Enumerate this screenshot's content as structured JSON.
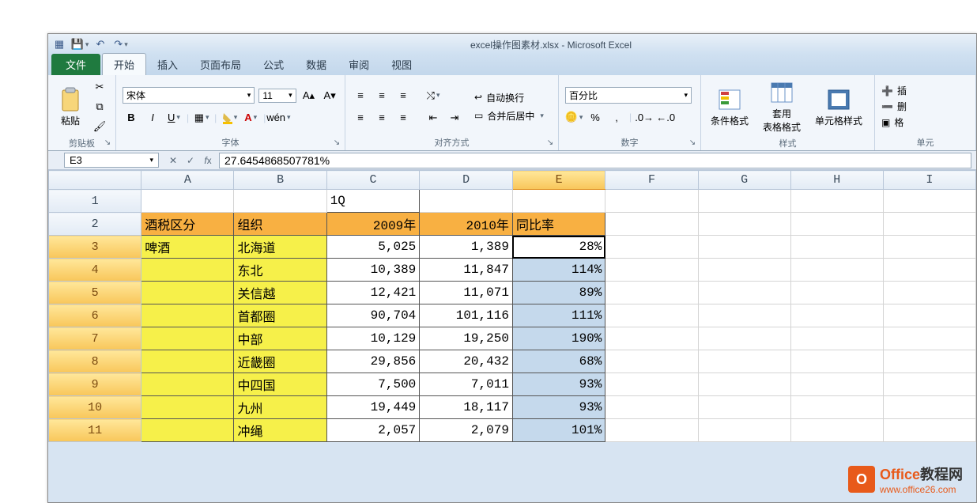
{
  "title": "excel操作图素材.xlsx - Microsoft Excel",
  "tabs": {
    "file": "文件",
    "home": "开始",
    "insert": "插入",
    "layout": "页面布局",
    "formulas": "公式",
    "data": "数据",
    "review": "审阅",
    "view": "视图"
  },
  "ribbon": {
    "clipboard": {
      "label": "剪贴板",
      "paste": "粘贴"
    },
    "font": {
      "label": "字体",
      "name": "宋体",
      "size": "11"
    },
    "alignment": {
      "label": "对齐方式",
      "wrap": "自动换行",
      "merge": "合并后居中"
    },
    "number": {
      "label": "数字",
      "format": "百分比"
    },
    "styles": {
      "label": "样式",
      "conditional": "条件格式",
      "table": "套用\n表格格式",
      "cell": "单元格样式"
    },
    "cells": {
      "label": "单元"
    },
    "cells_side": {
      "insert": "插",
      "delete": "删",
      "format": "格"
    }
  },
  "nameBox": "E3",
  "formula": "27.6454868507781%",
  "columns": [
    "A",
    "B",
    "C",
    "D",
    "E",
    "F",
    "G",
    "H",
    "I"
  ],
  "activeCol": "E",
  "rows": [
    1,
    2,
    3,
    4,
    5,
    6,
    7,
    8,
    9,
    10,
    11
  ],
  "activeRow": 3,
  "sheet": {
    "c1": "1Q",
    "headers": {
      "a": "酒税区分",
      "b": "组织",
      "c": "2009年",
      "d": "2010年",
      "e": "同比率"
    },
    "a3": "啤酒",
    "data": [
      {
        "b": "北海道",
        "c": "5,025",
        "d": "1,389",
        "e": "28%"
      },
      {
        "b": "东北",
        "c": "10,389",
        "d": "11,847",
        "e": "114%"
      },
      {
        "b": "关信越",
        "c": "12,421",
        "d": "11,071",
        "e": "89%"
      },
      {
        "b": "首都圈",
        "c": "90,704",
        "d": "101,116",
        "e": "111%"
      },
      {
        "b": "中部",
        "c": "10,129",
        "d": "19,250",
        "e": "190%"
      },
      {
        "b": "近畿圈",
        "c": "29,856",
        "d": "20,432",
        "e": "68%"
      },
      {
        "b": "中四国",
        "c": "7,500",
        "d": "7,011",
        "e": "93%"
      },
      {
        "b": "九州",
        "c": "19,449",
        "d": "18,117",
        "e": "93%"
      },
      {
        "b": "冲绳",
        "c": "2,057",
        "d": "2,079",
        "e": "101%"
      }
    ]
  },
  "watermark": {
    "brand1": "Office",
    "brand2": "教程网",
    "url": "www.office26.com"
  },
  "chart_data": {
    "type": "table",
    "title": "1Q",
    "categories": [
      "北海道",
      "东北",
      "关信越",
      "首都圈",
      "中部",
      "近畿圈",
      "中四国",
      "九州",
      "冲绳"
    ],
    "series": [
      {
        "name": "2009年",
        "values": [
          5025,
          10389,
          12421,
          90704,
          10129,
          29856,
          7500,
          19449,
          2057
        ]
      },
      {
        "name": "2010年",
        "values": [
          1389,
          11847,
          11071,
          101116,
          19250,
          20432,
          7011,
          18117,
          2079
        ]
      },
      {
        "name": "同比率",
        "values": [
          0.28,
          1.14,
          0.89,
          1.11,
          1.9,
          0.68,
          0.93,
          0.93,
          1.01
        ]
      }
    ],
    "row_group": "啤酒",
    "row_group_header": "酒税区分",
    "category_header": "组织"
  }
}
